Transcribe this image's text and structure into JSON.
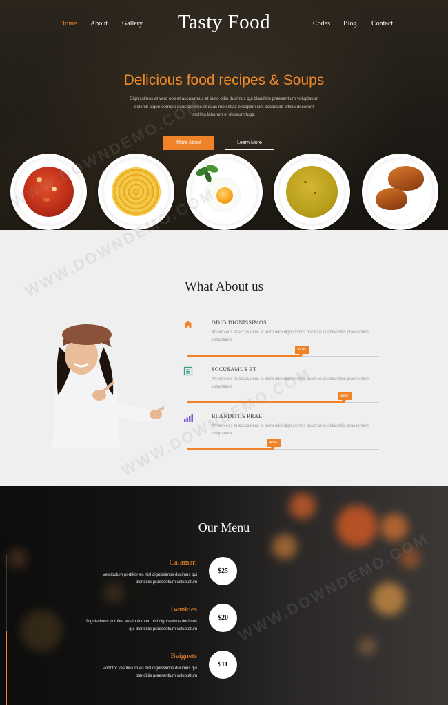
{
  "nav": {
    "left": [
      "Home",
      "About",
      "Gallery"
    ],
    "right": [
      "Codes",
      "Blog",
      "Contact"
    ],
    "active": "Home"
  },
  "brand": {
    "logo": "Tasty Food"
  },
  "hero": {
    "title": "Delicious food recipes & Soups",
    "text": "Dignissimos at vero eos et accusamus et iusto odio ducimus qui blanditiis praesentium voluptatum deleniti atque corrupti quos dolores et quas molestias excepturi sint occaecati officia deserunt mollitia laborum et dolorum fuga.",
    "primary_button": "More About",
    "secondary_button": "Learn More",
    "plates": [
      "tomato-soup",
      "spaghetti",
      "fried-egg",
      "pumpkin-soup",
      "croissants"
    ]
  },
  "about": {
    "title": "What About us",
    "features": [
      {
        "title": "ODIO DIGNISSIMOS",
        "text": "At vero eos et accusamus et iusto odio dignissimos ducimus qui blanditiis praesentium voluptatum",
        "percent": 60,
        "percent_label": "60%",
        "icon": "home-icon"
      },
      {
        "title": "SCCUSAMUS ET",
        "text": "At vero eos et accusamus et iusto odio dignissimos ducimus qui blanditiis praesentium voluptatum",
        "percent": 82,
        "percent_label": "82%",
        "icon": "document-icon"
      },
      {
        "title": "BLANDITIIS PRAE",
        "text": "At vero eos et accusamus et iusto odio dignissimos ducimus qui blanditiis praesentium voluptatum",
        "percent": 45,
        "percent_label": "45%",
        "icon": "bar-chart-icon"
      }
    ]
  },
  "menu": {
    "title": "Our Menu",
    "items": [
      {
        "name": "Calamari",
        "description": "Vestibulum porttitor eu nisl dignissimos ducimus qui blanditiis praesentium voluptatum",
        "price": "$25"
      },
      {
        "name": "Twinkies",
        "description": "Dignissimos porttitor vestibulum eu nisl dignissimos ducimus qui blanditiis praesentium voluptatum",
        "price": "$20"
      },
      {
        "name": "Beignets",
        "description": "Porttitor vestibulum eu nisl dignissimos ducimus qui blanditiis praesentium voluptatum",
        "price": "$11"
      }
    ]
  },
  "watermark": "WWW.DOWNDEMO.COM",
  "colors": {
    "accent": "#f0832a",
    "about_bg": "#efefef",
    "hero_bg": "#1d1a15"
  }
}
